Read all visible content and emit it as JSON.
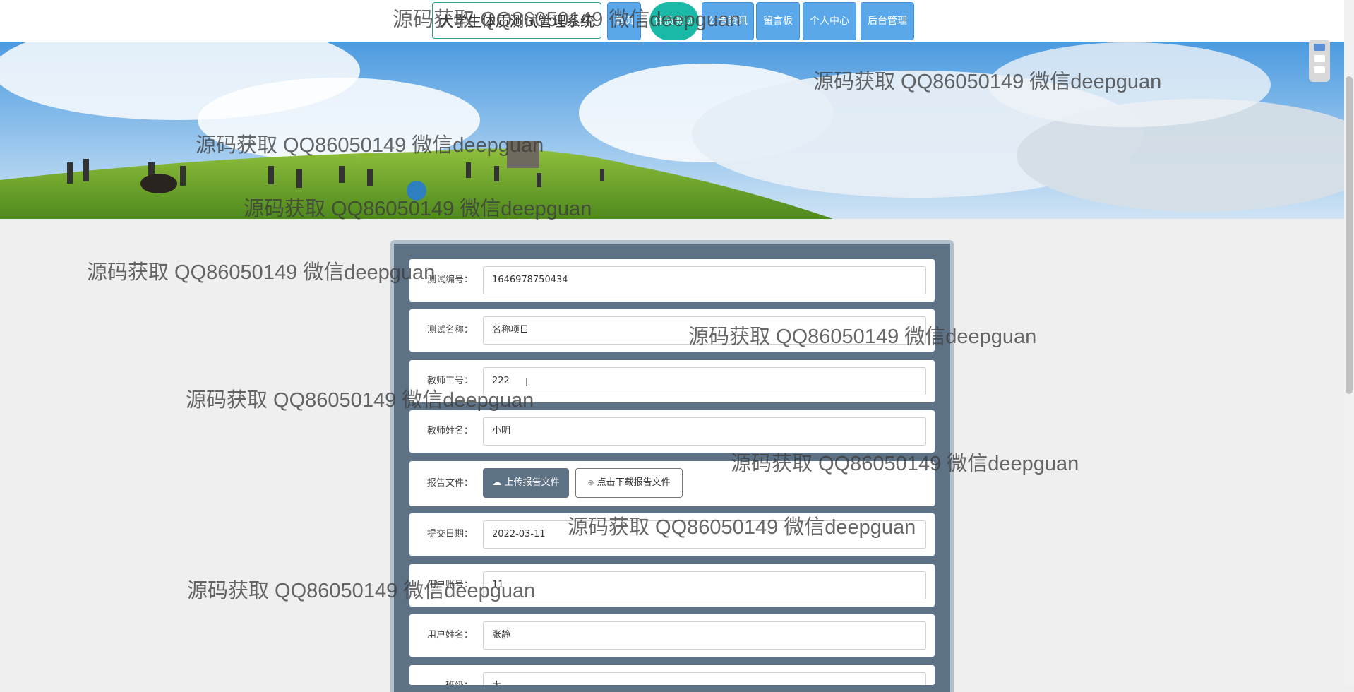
{
  "nav": {
    "site_title": "大学生体质测试管理系统",
    "items": [
      "首页",
      "体质测试",
      "公告资讯",
      "留言板",
      "个人中心",
      "后台管理"
    ]
  },
  "form": {
    "test_no": {
      "label": "测试编号：",
      "value": "1646978750434"
    },
    "test_name": {
      "label": "测试名称：",
      "value": "名称项目"
    },
    "teacher_no": {
      "label": "教师工号：",
      "value": "222"
    },
    "teacher_name": {
      "label": "教师姓名：",
      "value": "小明"
    },
    "report_file": {
      "label": "报告文件：",
      "upload": "上传报告文件",
      "download": "点击下载报告文件"
    },
    "submit_date": {
      "label": "提交日期：",
      "value": "2022-03-11"
    },
    "user_account": {
      "label": "用户账号：",
      "value": "11"
    },
    "user_name": {
      "label": "用户姓名：",
      "value": "张静"
    },
    "class": {
      "label": "班级：",
      "value": "大"
    }
  },
  "watermark": "源码获取 QQ86050149 微信deepguan",
  "colors": {
    "nav_button": "#5aa8ea",
    "nav_active": "#1ab8a6",
    "form_panel": "#5e7286"
  }
}
